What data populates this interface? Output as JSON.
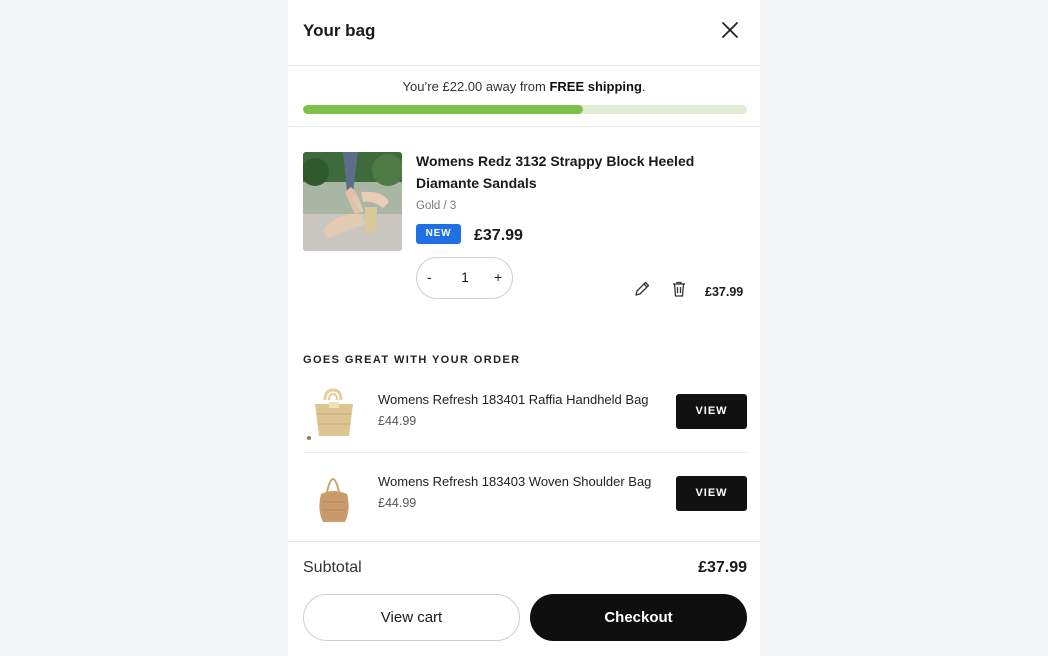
{
  "bag": {
    "title": "Your bag"
  },
  "shipping": {
    "prefix": "You’re £22.00 away from ",
    "highlight": "FREE shipping",
    "suffix": ".",
    "progress_percent": 63,
    "bar_color": "#7cc24a",
    "track_color": "#e1ecd3"
  },
  "item": {
    "name": "Womens Redz 3132 Strappy Block Heeled Diamante Sandals",
    "variant": "Gold / 3",
    "badge": "NEW",
    "badge_color": "#1f6fe5",
    "price": "£37.99",
    "quantity": "1",
    "minus": "-",
    "plus": "+",
    "line_total": "£37.99"
  },
  "upsell": {
    "title": "GOES GREAT WITH YOUR ORDER",
    "items": [
      {
        "name": "Womens Refresh 183401 Raffia Handheld Bag",
        "price": "£44.99",
        "button": "VIEW"
      },
      {
        "name": "Womens Refresh 183403 Woven Shoulder Bag",
        "price": "£44.99",
        "button": "VIEW"
      }
    ]
  },
  "footer": {
    "subtotal_label": "Subtotal",
    "subtotal_value": "£37.99",
    "view_cart": "View cart",
    "checkout": "Checkout"
  }
}
